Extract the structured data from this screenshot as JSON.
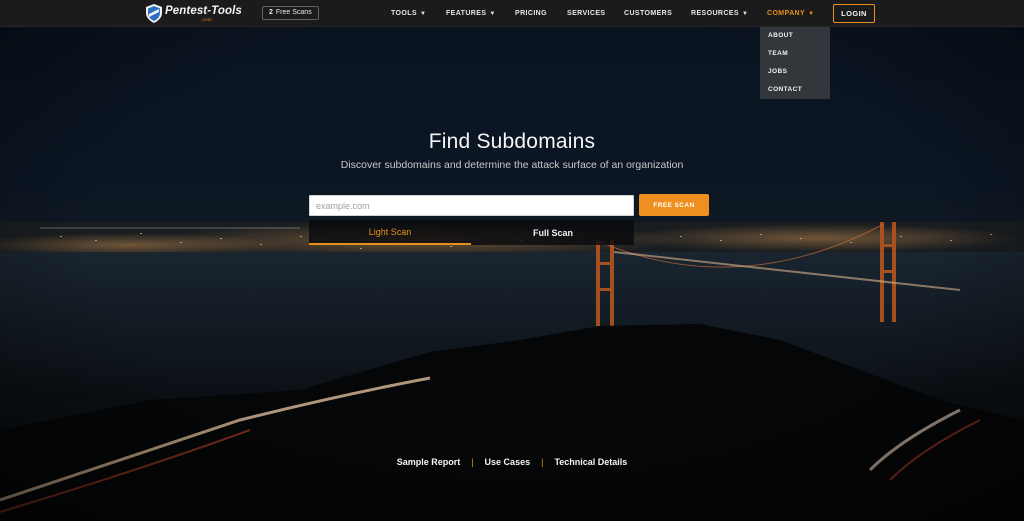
{
  "brand": {
    "logo_text": "Pentest-Tools",
    "logo_sub": ".com"
  },
  "nav": {
    "free_scans_count": "2",
    "free_scans_label": "Free Scans",
    "items": [
      {
        "label": "TOOLS",
        "caret": "▼"
      },
      {
        "label": "FEATURES",
        "caret": "▼"
      },
      {
        "label": "PRICING",
        "caret": ""
      },
      {
        "label": "SERVICES",
        "caret": ""
      },
      {
        "label": "CUSTOMERS",
        "caret": ""
      },
      {
        "label": "RESOURCES",
        "caret": "▼"
      },
      {
        "label": "COMPANY",
        "caret": "▼"
      }
    ],
    "login_label": "LOGIN"
  },
  "company_dropdown": {
    "items": [
      "ABOUT",
      "TEAM",
      "JOBS",
      "CONTACT"
    ]
  },
  "hero": {
    "title": "Find Subdomains",
    "subtitle": "Discover subdomains and determine the attack surface of an organization",
    "input_value": "",
    "input_placeholder": "example.com",
    "scan_button": "FREE SCAN",
    "tabs": [
      {
        "label": "Light Scan",
        "selected": true
      },
      {
        "label": "Full Scan",
        "selected": false
      }
    ]
  },
  "bottom_links": {
    "items": [
      "Sample Report",
      "Use Cases",
      "Technical Details"
    ],
    "separator": "|"
  },
  "colors": {
    "accent": "#ef8f1f",
    "nav_bg": "#1b1b1b",
    "dropdown_bg": "#33363b"
  },
  "icons": {
    "logo": "shield-logo-icon",
    "caret": "caret-down-icon"
  }
}
